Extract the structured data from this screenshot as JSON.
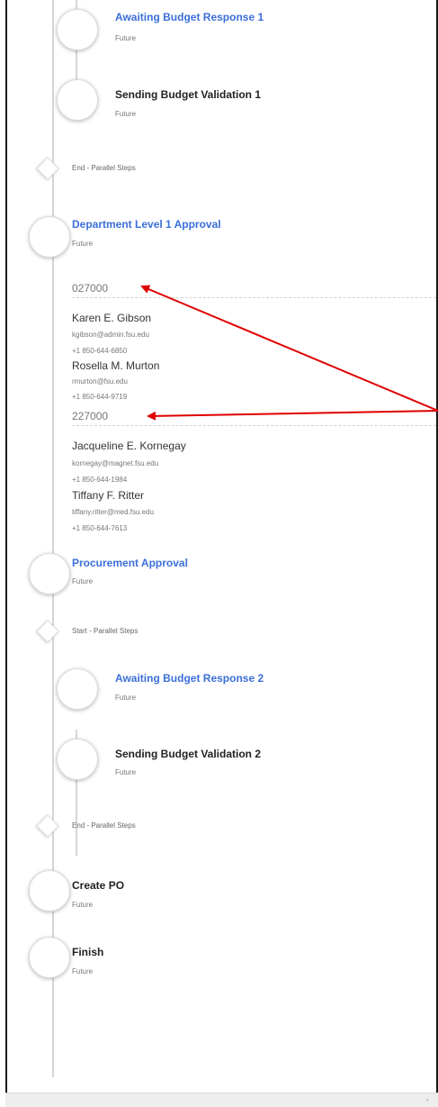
{
  "steps": [
    {
      "title": "Awaiting Budget Response 1",
      "status": "Future"
    },
    {
      "title": "Sending Budget Validation 1",
      "status": "Future"
    },
    {
      "title": "Department Level 1 Approval",
      "status": "Future"
    },
    {
      "title": "Procurement Approval",
      "status": "Future"
    },
    {
      "title": "Awaiting Budget Response 2",
      "status": "Future"
    },
    {
      "title": "Sending Budget Validation 2",
      "status": "Future"
    },
    {
      "title": "Create PO",
      "status": "Future"
    },
    {
      "title": "Finish",
      "status": "Future"
    }
  ],
  "markers": {
    "end_parallel_1": "End - Parallel Steps",
    "start_parallel": "Start - Parallel Steps",
    "end_parallel_2": "End - Parallel Steps"
  },
  "approver_groups": [
    {
      "code": "027000",
      "people": [
        {
          "name": "Karen E. Gibson",
          "email": "kgibson@admin.fsu.edu",
          "phone": "+1 850-644-6850"
        },
        {
          "name": "Rosella M. Murton",
          "email": "rmurton@fsu.edu",
          "phone": "+1 850-644-9719"
        }
      ]
    },
    {
      "code": "227000",
      "people": [
        {
          "name": "Jacqueline E. Kornegay",
          "email": "kornegay@magnet.fsu.edu",
          "phone": "+1 850-644-1984"
        },
        {
          "name": "Tiffany F. Ritter",
          "email": "tiffany.ritter@med.fsu.edu",
          "phone": "+1 850-644-7613"
        }
      ]
    }
  ],
  "colors": {
    "link_blue": "#3b6fd9",
    "annotation_red": "#e00000"
  }
}
